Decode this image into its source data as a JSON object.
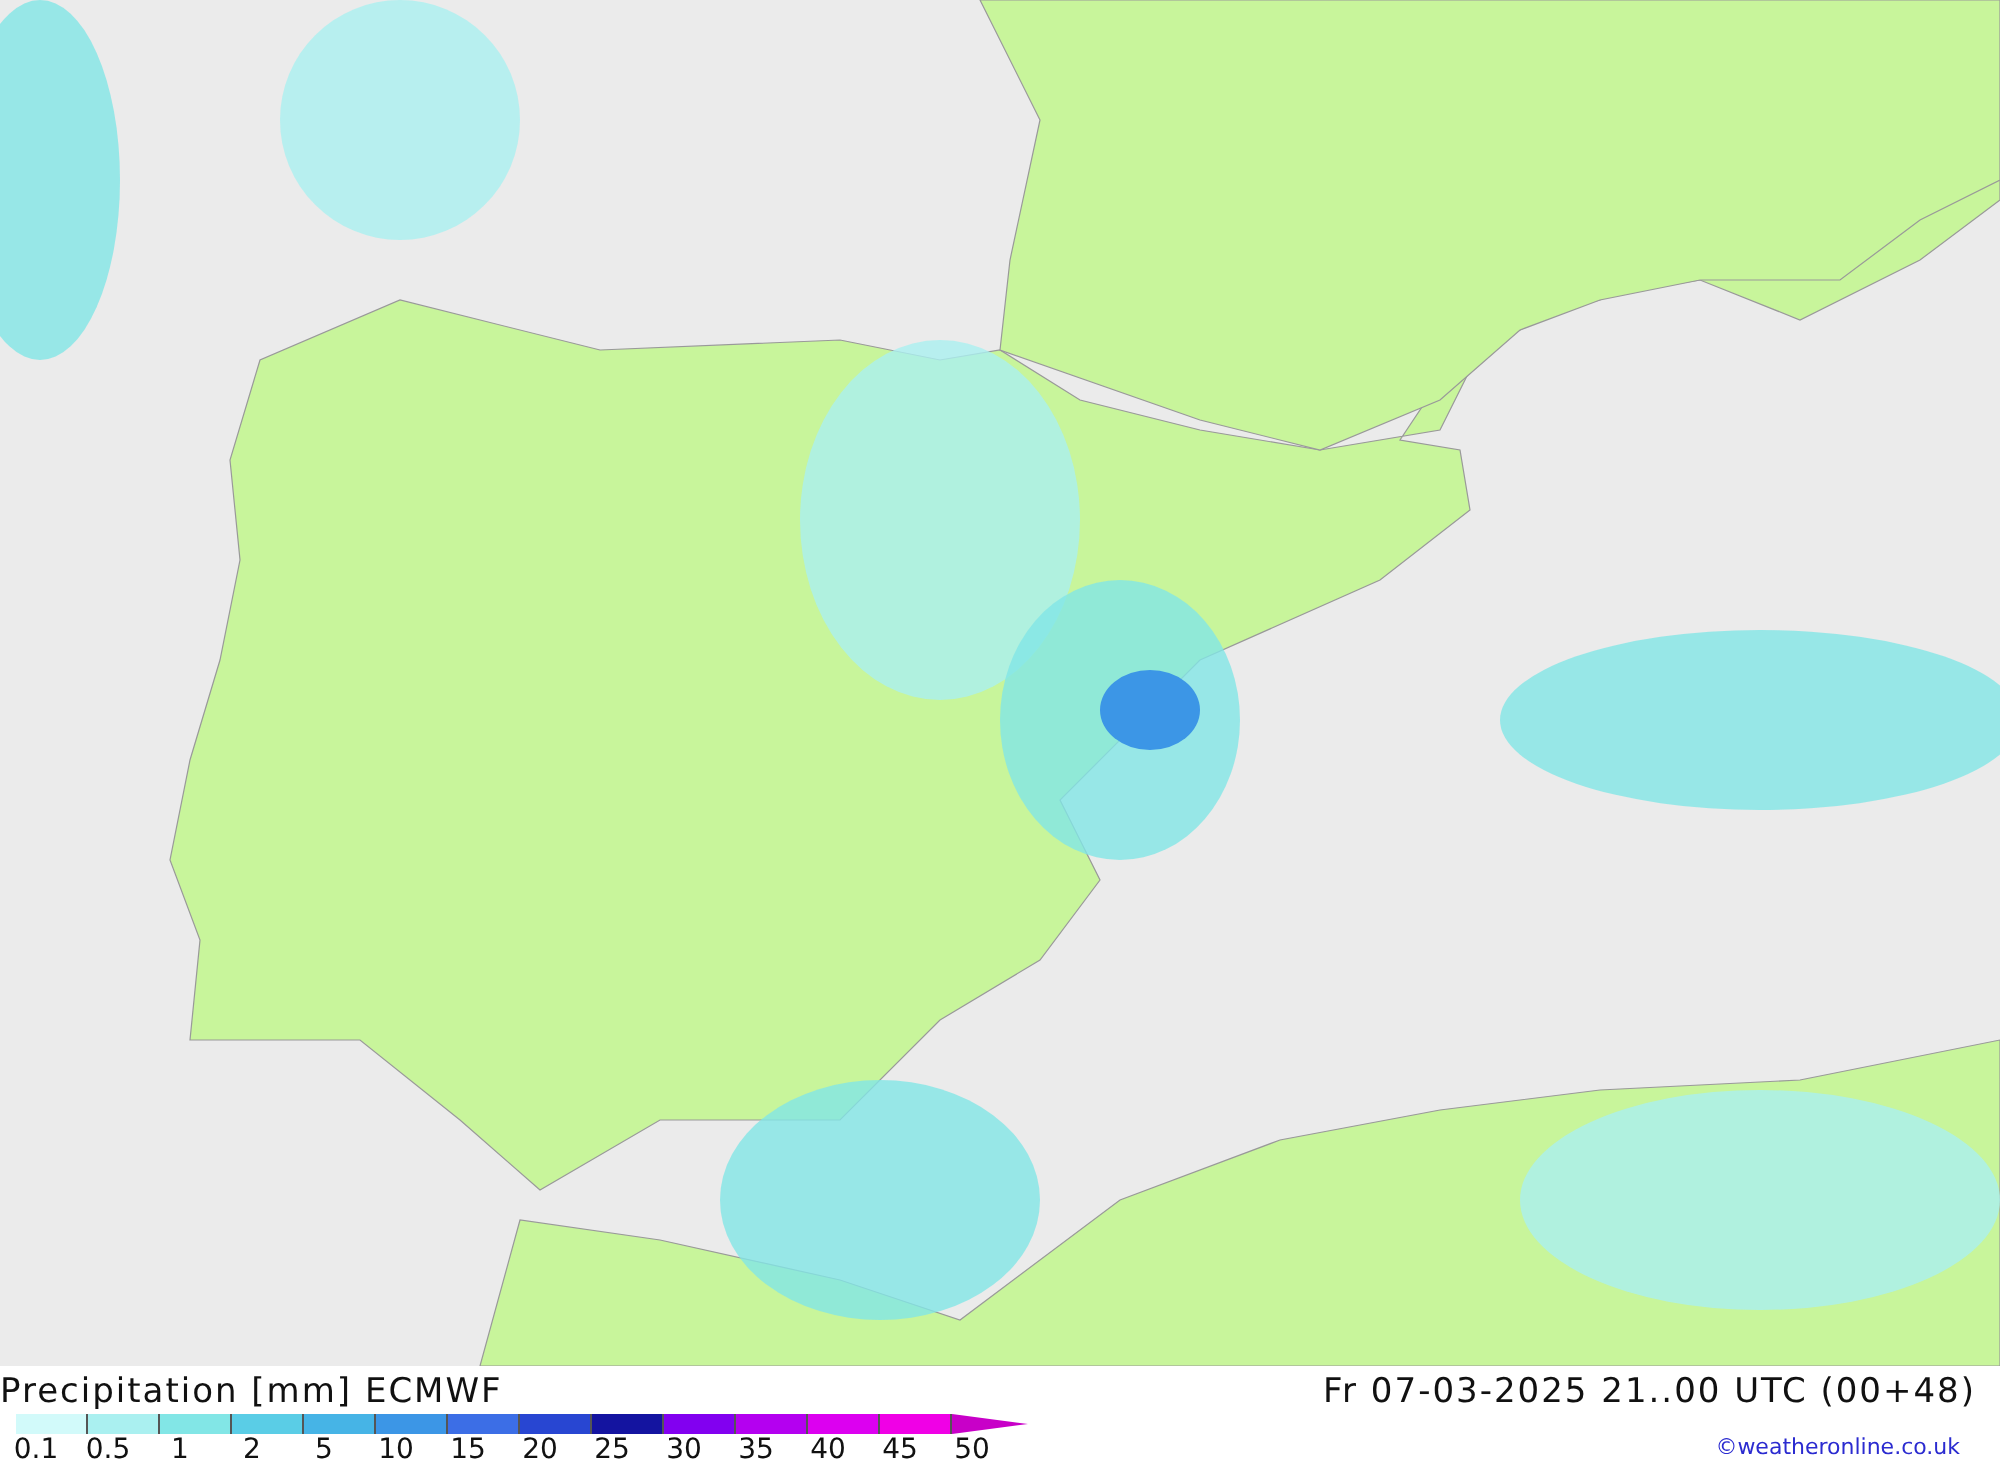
{
  "title": "Precipitation [mm] ECMWF",
  "valid_time": "Fr 07-03-2025 21..00 UTC (00+48)",
  "credit": "©weatheronline.co.uk",
  "scale": [
    {
      "label": "0.1",
      "color": "#d2fafa"
    },
    {
      "label": "0.5",
      "color": "#aaf0f0"
    },
    {
      "label": "1",
      "color": "#82e6e6"
    },
    {
      "label": "2",
      "color": "#5acde6"
    },
    {
      "label": "5",
      "color": "#46b4e6"
    },
    {
      "label": "10",
      "color": "#3c96e6"
    },
    {
      "label": "15",
      "color": "#3c6ee6"
    },
    {
      "label": "20",
      "color": "#2846d2"
    },
    {
      "label": "25",
      "color": "#1414a0"
    },
    {
      "label": "30",
      "color": "#8200f0"
    },
    {
      "label": "35",
      "color": "#b400f0"
    },
    {
      "label": "40",
      "color": "#dc00f0"
    },
    {
      "label": "45",
      "color": "#f000e6"
    },
    {
      "label": "50",
      "color": "#c800c8"
    }
  ]
}
